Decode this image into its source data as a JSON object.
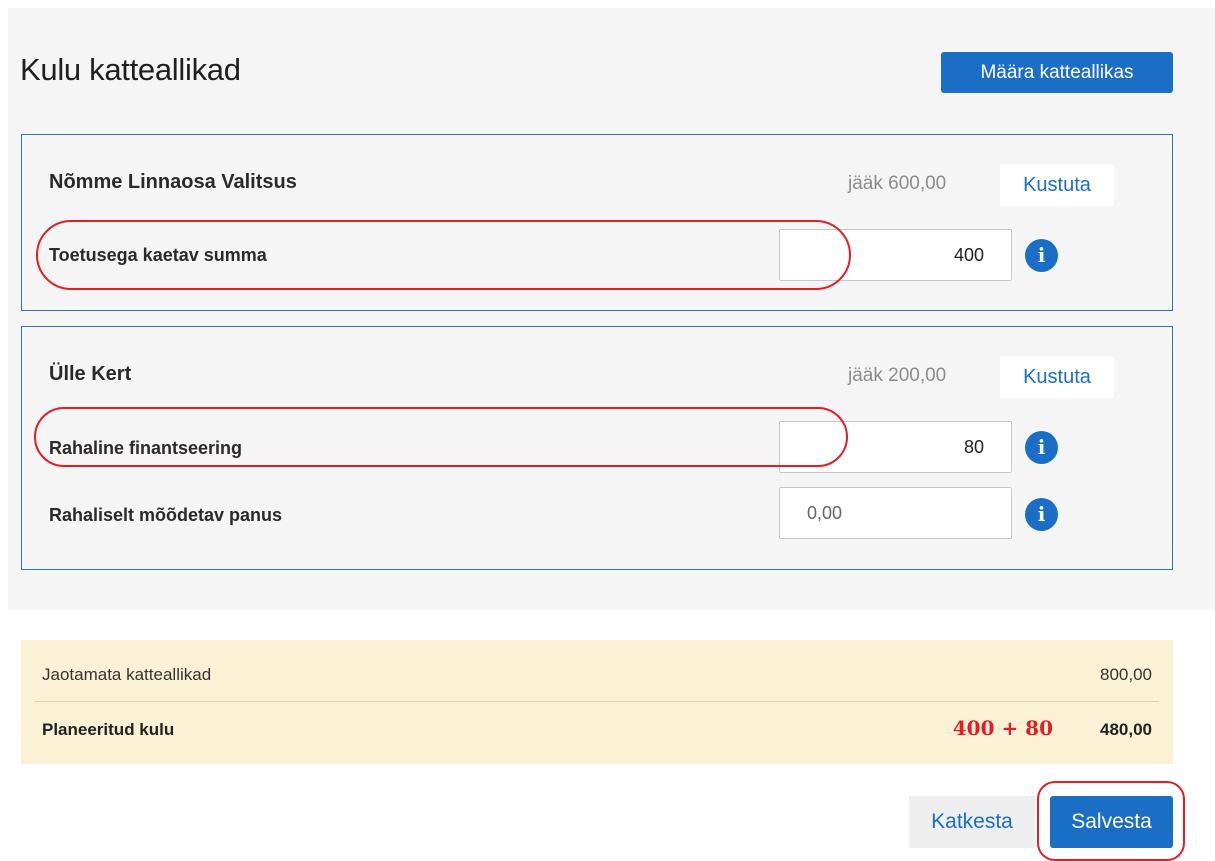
{
  "header": {
    "title": "Kulu katteallikad",
    "assign_button_label": "Määra katteallikas"
  },
  "sources": [
    {
      "name": "Nõmme Linnaosa Valitsus",
      "balance": "jääk 600,00",
      "delete_label": "Kustuta",
      "fields": [
        {
          "label": "Toetusega kaetav summa",
          "value": "400",
          "info_icon": "info-icon"
        }
      ]
    },
    {
      "name": "Ülle Kert",
      "balance": "jääk 200,00",
      "delete_label": "Kustuta",
      "fields": [
        {
          "label": "Rahaline finantseering",
          "value": "80",
          "info_icon": "info-icon"
        },
        {
          "label": "Rahaliselt mõõdetav panus",
          "value": "0,00",
          "info_icon": "info-icon"
        }
      ]
    }
  ],
  "summary": {
    "unallocated_label": "Jaotamata katteallikad",
    "unallocated_value": "800,00",
    "planned_label": "Planeeritud kulu",
    "planned_value": "480,00",
    "annotation_sum": "400 + 80"
  },
  "footer": {
    "cancel_label": "Katkesta",
    "save_label": "Salvesta"
  },
  "colors": {
    "accent": "#1a6ec6",
    "annotation": "#e41c23",
    "summary_background": "#fbf2d5"
  }
}
